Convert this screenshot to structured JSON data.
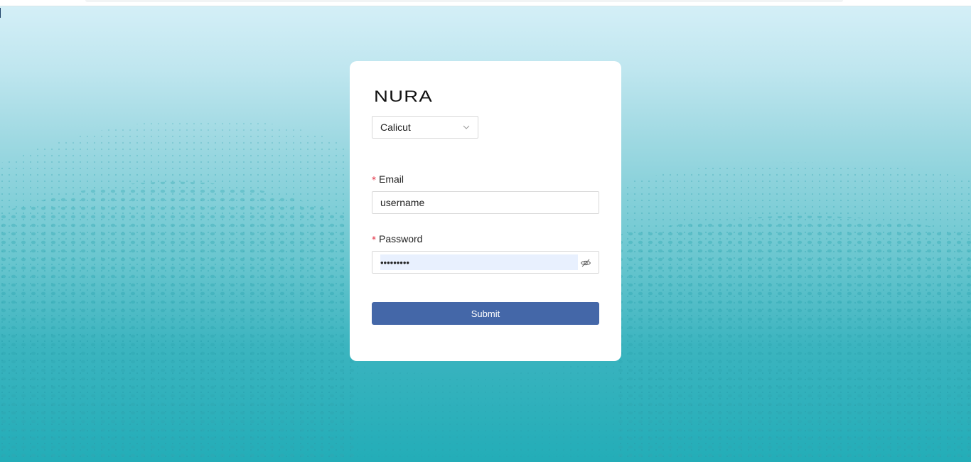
{
  "brand": {
    "logo_text": "NURA"
  },
  "location_select": {
    "selected": "Calicut"
  },
  "form": {
    "email": {
      "label": "Email",
      "required_mark": "*",
      "value": "username"
    },
    "password": {
      "label": "Password",
      "required_mark": "*",
      "value": "•••••••••"
    },
    "submit_label": "Submit"
  },
  "icons": {
    "select_chevron": "chevron-down-icon",
    "password_toggle": "eye-off-icon"
  },
  "colors": {
    "accent": "#4467a8",
    "required": "#e0283c",
    "background_top": "#d6f0f8",
    "background_bottom": "#23adb8",
    "autofill_bg": "#e8f0fe"
  }
}
